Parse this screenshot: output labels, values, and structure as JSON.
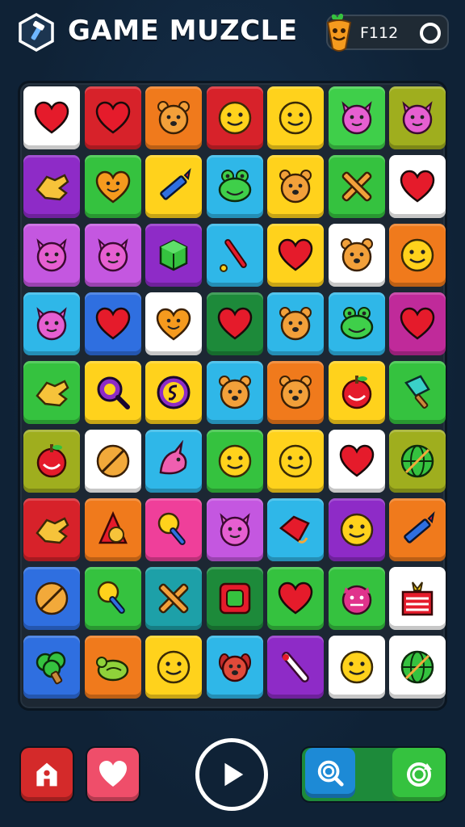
{
  "header": {
    "title": "GAME MUZCLE",
    "coin_value": "F112",
    "logo_icon": "shield-hammer-icon",
    "coin_icon": "carrot-icon",
    "settings_icon": "ring-icon"
  },
  "colors": {
    "background": "#0f2236",
    "board": "#1c2733",
    "play_button_border": "#ffffff"
  },
  "board": {
    "rows": 9,
    "cols": 7,
    "tiles": [
      [
        "heart-icon:#ffffff",
        "heart-icon:#d7222a",
        "bear-face-icon:#f07a1c",
        "smiley-face-icon:#d7222a",
        "smiley-face-icon:#ffd21c",
        "cat-face-icon:#3fcf4a",
        "cat-face-icon:#9fae1e"
      ],
      [
        "hand-icon:#8e2bc7",
        "heart-face-icon:#35c23f",
        "pencil-icon:#ffd21c",
        "frog-face-icon:#2fb7e8",
        "bear-face-icon:#ffd21c",
        "cross-icon:#35c23f",
        "heart-icon:#ffffff"
      ],
      [
        "cat-face-icon:#c457e0",
        "cat-face-icon:#c457e0",
        "cube-icon:#8e2bc7",
        "bat-icon:#2fb7e8",
        "heart-icon:#ffd21c",
        "bear-face-icon:#ffffff",
        "smiley-face-icon:#f07a1c"
      ],
      [
        "cat-face-icon:#2fb7e8",
        "heart-icon:#2f6fe0",
        "heart-face-icon:#ffffff",
        "heart-icon:#1d8a3a",
        "bear-face-icon:#2fb7e8",
        "frog-face-icon:#2fb7e8",
        "heart-icon:#c02a9a"
      ],
      [
        "hand-icon:#35c23f",
        "magnifier-icon:#ffd21c",
        "coin-icon:#ffd21c",
        "bear-face-icon:#2fb7e8",
        "bear-face-icon:#f07a1c",
        "apple-icon:#ffd21c",
        "ice-cream-icon:#35c23f"
      ],
      [
        "apple-icon:#9fae1e",
        "ball-icon:#ffffff",
        "unicorn-icon:#2fb7e8",
        "smiley-face-icon:#35c23f",
        "smiley-face-icon:#ffd21c",
        "heart-icon:#ffffff",
        "globe-icon:#9fae1e"
      ],
      [
        "hand-icon:#d7222a",
        "triangle-hand-icon:#f07a1c",
        "lollipop-icon:#ef3f9a",
        "cat-face-icon:#c457e0",
        "kite-icon:#2fb7e8",
        "smiley-face-icon:#8e2bc7",
        "pencil-icon:#f07a1c"
      ],
      [
        "ball-icon:#2f6fe0",
        "lollipop-icon:#35c23f",
        "cross-icon:#1da0a8",
        "square-icon:#1d8a3a",
        "heart-icon:#35c23f",
        "dragon-face-icon:#35c23f",
        "box-icon:#ffffff"
      ],
      [
        "broccoli-icon:#2f6fe0",
        "turtle-icon:#f07a1c",
        "smiley-face-icon:#ffd21c",
        "dog-face-icon:#2fb7e8",
        "stick-icon:#8e2bc7",
        "smiley-face-icon:#ffffff",
        "globe-icon:#ffffff"
      ]
    ]
  },
  "bottom_bar": {
    "home_icon": "home-icon",
    "lives_icon": "heart-icon",
    "play_icon": "play-icon",
    "search_icon": "search-icon",
    "refresh_icon": "refresh-icon"
  }
}
